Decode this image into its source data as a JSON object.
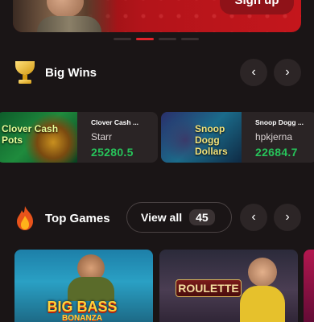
{
  "banner": {
    "signup_label": "Sign up"
  },
  "big_wins": {
    "title": "Big Wins",
    "items": [
      {
        "game": "Clover Cash ...",
        "user": "Starr",
        "amount": "25280.5",
        "thumb_text": "Clover Cash Pots"
      },
      {
        "game": "Snoop Dogg ...",
        "user": "hpkjerna",
        "amount": "22684.7",
        "thumb_text": "Snoop Dogg Dollars"
      }
    ]
  },
  "top_games": {
    "title": "Top Games",
    "view_all_label": "View all",
    "view_all_count": "45",
    "games": [
      {
        "title": "BIG BASS",
        "subtitle": "BONANZA"
      },
      {
        "title": "ROULETTE"
      }
    ]
  }
}
